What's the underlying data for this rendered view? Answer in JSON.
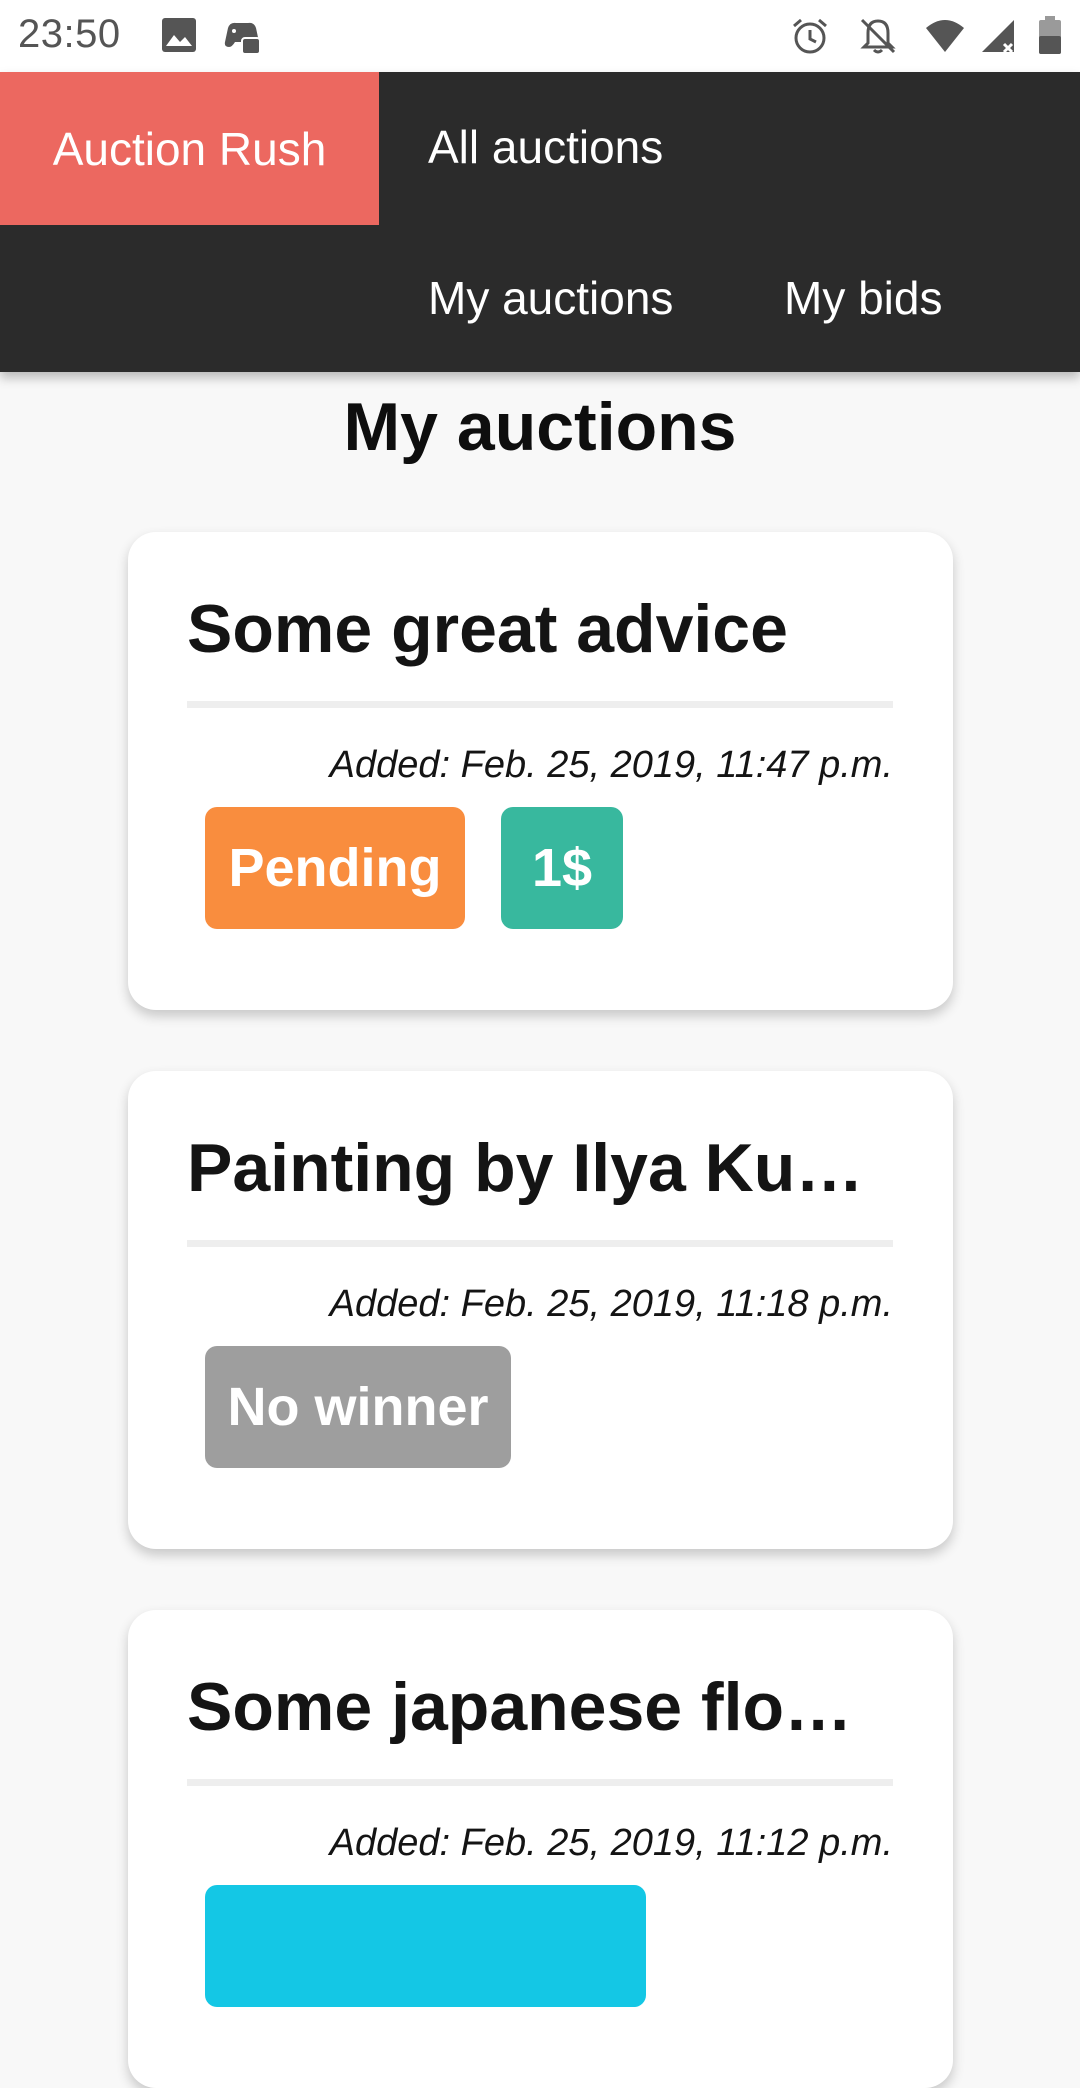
{
  "status_bar": {
    "time": "23:50",
    "left_icons": [
      "image-icon",
      "game-controller-icon"
    ],
    "right_icons": [
      "alarm-clock-icon",
      "notifications-off-icon",
      "wifi-icon",
      "cell-signal-icon",
      "battery-icon"
    ]
  },
  "nav": {
    "brand": "Auction Rush",
    "links": [
      "All auctions",
      "My auctions",
      "My bids"
    ],
    "colors": {
      "bar": "#2b2b2b",
      "brand": "#ec6860"
    }
  },
  "page": {
    "title": "My auctions"
  },
  "auctions": [
    {
      "title": "Some great advice",
      "added": "Added: Feb. 25, 2019, 11:47 p.m.",
      "tags": [
        {
          "label": "Pending",
          "color": "#f98d3e"
        },
        {
          "label": "1$",
          "color": "#38b89e"
        }
      ]
    },
    {
      "title": "Painting by Ilya Kuvshinov",
      "added": "Added: Feb. 25, 2019, 11:18 p.m.",
      "tags": [
        {
          "label": "No winner",
          "color": "#9e9e9e"
        }
      ]
    },
    {
      "title": "Some japanese flowers",
      "added": "Added: Feb. 25, 2019, 11:12 p.m.",
      "tags": [
        {
          "label": "",
          "color": "#14c7e5"
        }
      ]
    }
  ]
}
